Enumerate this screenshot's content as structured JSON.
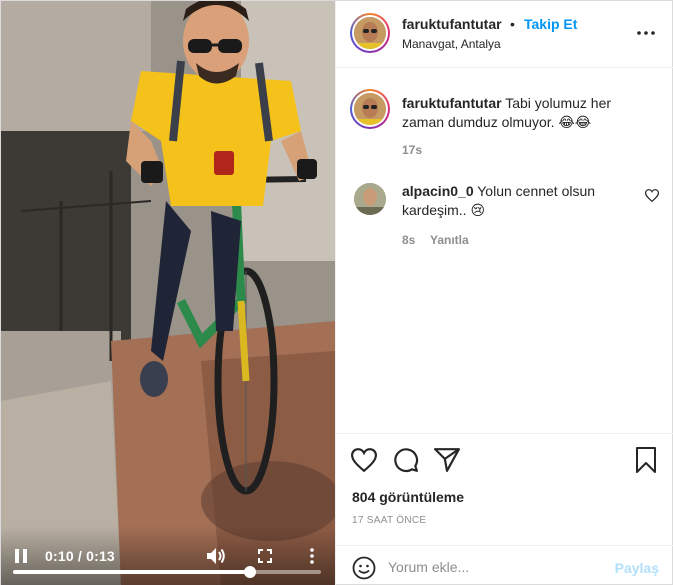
{
  "video": {
    "time_display": "0:10 / 0:13",
    "progress_fraction": 0.77
  },
  "header": {
    "username": "faruktufantutar",
    "separator": "•",
    "follow_label": "Takip Et",
    "location": "Manavgat, Antalya"
  },
  "caption": {
    "username": "faruktufantutar",
    "text": "Tabi yolumuz her zaman dumduz olmuyor. 😂😂",
    "time": "17s"
  },
  "comments": [
    {
      "username": "alpacin0_0",
      "text": "Yolun cennet olsun kardeşim.. 😢",
      "time": "8s",
      "reply_label": "Yanıtla"
    }
  ],
  "stats": {
    "views": "804 görüntüleme",
    "posted": "17 SAAT ÖNCE"
  },
  "composer": {
    "placeholder": "Yorum ekle...",
    "share_label": "Paylaş"
  },
  "colors": {
    "link_blue": "#0095f6",
    "share_disabled": "#b2dffc",
    "muted": "#8e8e8e"
  }
}
